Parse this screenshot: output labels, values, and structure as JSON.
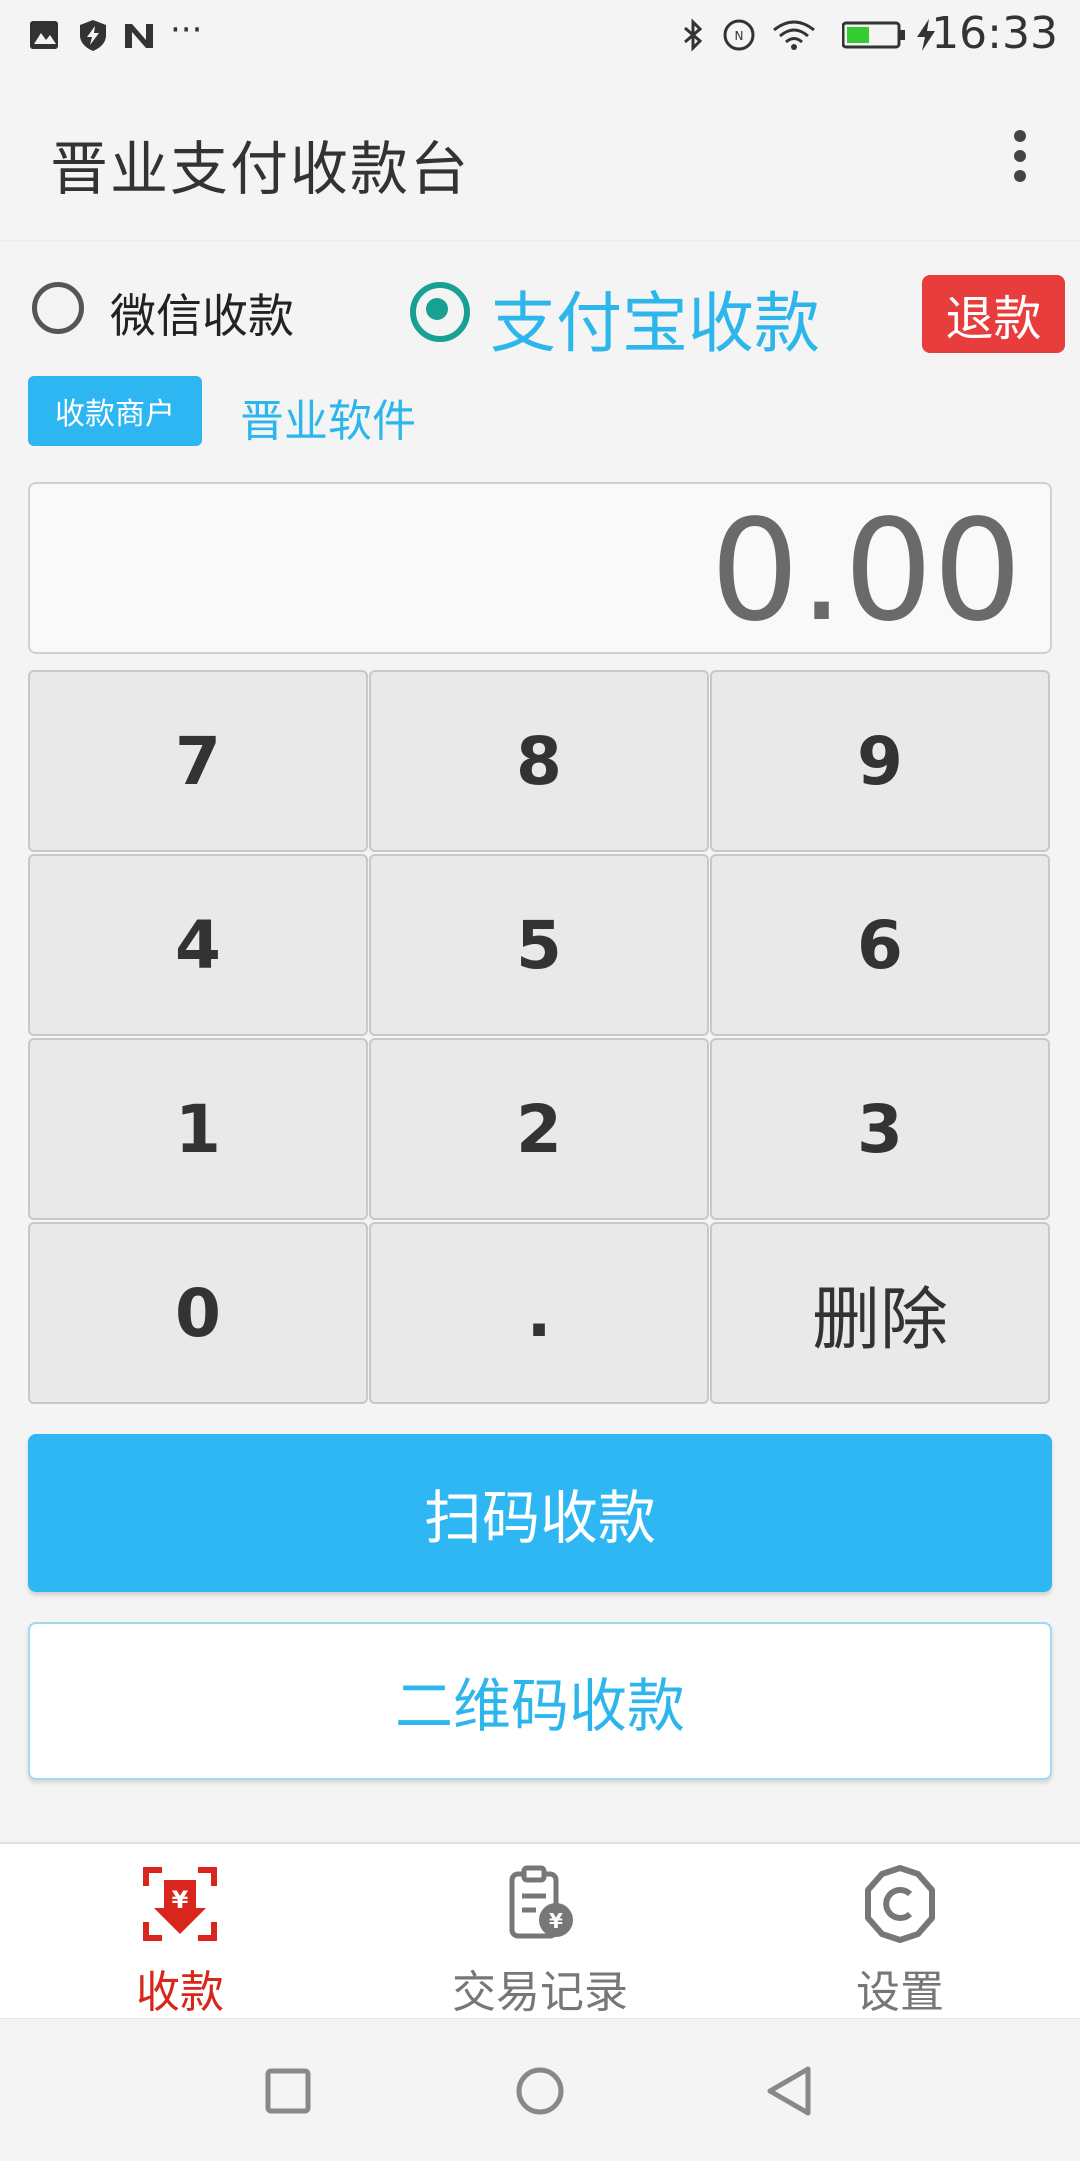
{
  "status_bar": {
    "time": "16:33",
    "left_icons": [
      "image-icon",
      "shield-bolt-icon",
      "n-app-icon",
      "more-dots-icon"
    ],
    "right_icons": [
      "bluetooth-icon",
      "nfc-icon",
      "wifi-icon",
      "battery-icon",
      "charging-bolt-icon"
    ],
    "battery_level": 0.45,
    "more_text": "···"
  },
  "app_bar": {
    "title": "晋业支付收款台"
  },
  "payment_methods": {
    "wechat_label": "微信收款",
    "alipay_label": "支付宝收款",
    "selected": "alipay"
  },
  "refund_label": "退款",
  "merchant": {
    "badge_label": "收款商户",
    "name": "晋业软件"
  },
  "amount": "0.00",
  "keypad": {
    "rows": [
      [
        "7",
        "8",
        "9"
      ],
      [
        "4",
        "5",
        "6"
      ],
      [
        "1",
        "2",
        "3"
      ],
      [
        "0",
        ".",
        "删除"
      ]
    ]
  },
  "actions": {
    "scan_label": "扫码收款",
    "qr_label": "二维码收款"
  },
  "bottom_nav": {
    "items": [
      {
        "label": "收款",
        "icon": "scan-pay-icon",
        "active": true
      },
      {
        "label": "交易记录",
        "icon": "transaction-record-icon",
        "active": false
      },
      {
        "label": "设置",
        "icon": "settings-gear-icon",
        "active": false
      }
    ]
  },
  "colors": {
    "accent": "#2db6ec",
    "refund": "#e83d3d",
    "active_nav": "#d9261c",
    "radio_selected": "#1aa093"
  }
}
